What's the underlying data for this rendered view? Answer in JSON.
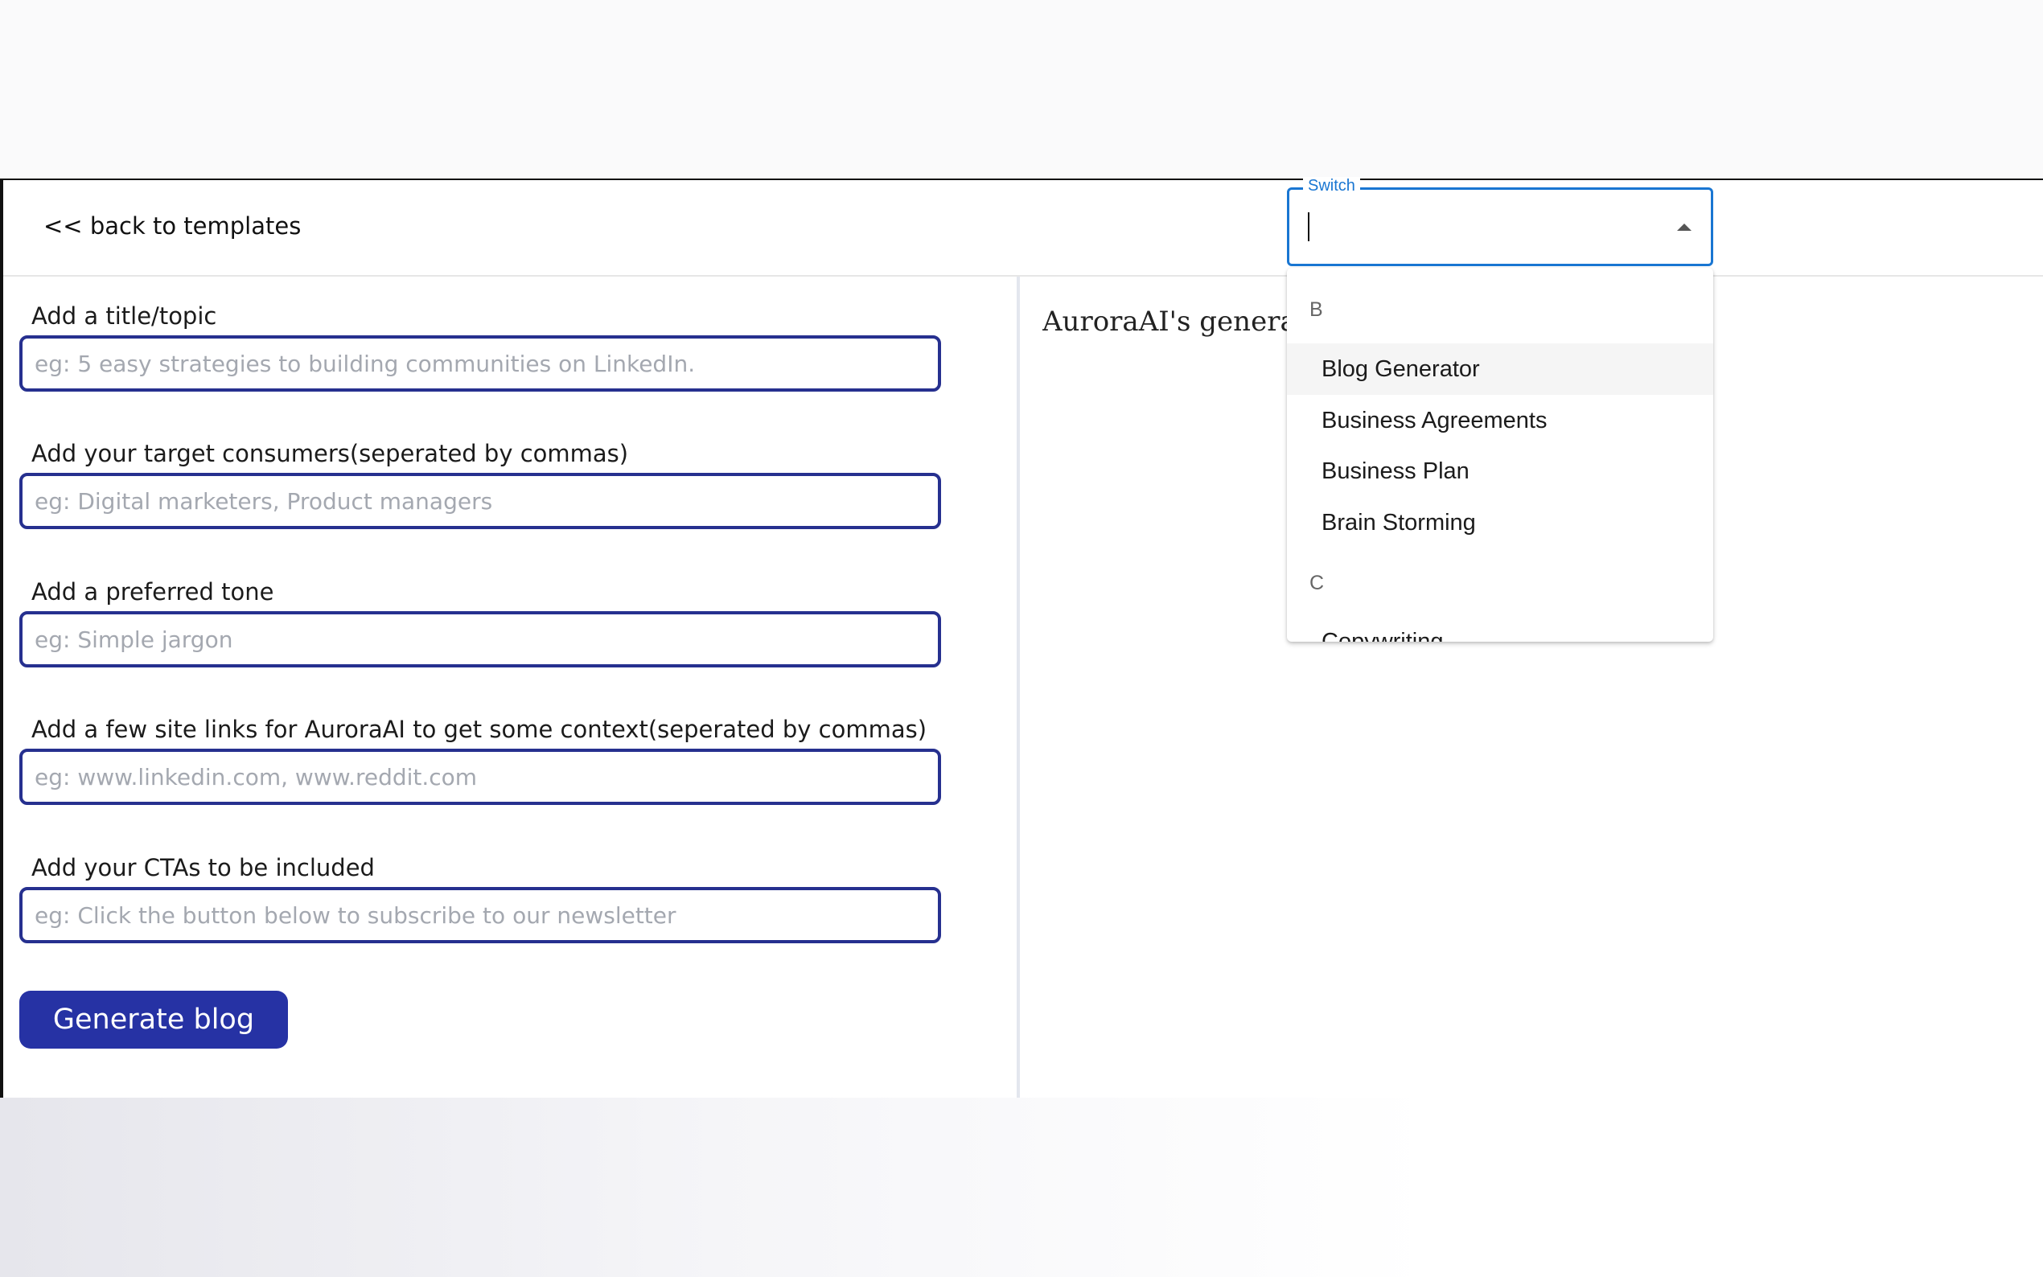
{
  "header": {
    "back_link": "<< back to templates"
  },
  "form": {
    "fields": [
      {
        "label": "Add a title/topic",
        "placeholder": "eg: 5 easy strategies to building communities on LinkedIn."
      },
      {
        "label": "Add your target consumers(seperated by commas)",
        "placeholder": "eg: Digital marketers, Product managers"
      },
      {
        "label": "Add a preferred tone",
        "placeholder": "eg: Simple jargon"
      },
      {
        "label": "Add a few site links for AuroraAI to get some context(seperated by commas)",
        "placeholder": "eg: www.linkedin.com, www.reddit.com"
      },
      {
        "label": "Add your CTAs to be included",
        "placeholder": "eg: Click the button below to subscribe to our newsletter"
      }
    ],
    "submit_label": "Generate blog"
  },
  "output": {
    "text": "AuroraAI's generati"
  },
  "switch": {
    "label": "Switch",
    "value": "",
    "groups": [
      {
        "header": "B",
        "options": [
          "Blog Generator",
          "Business Agreements",
          "Business Plan",
          "Brain Storming"
        ]
      },
      {
        "header": "C",
        "options": [
          "Copywriting"
        ]
      }
    ],
    "highlighted": "Blog Generator"
  },
  "colors": {
    "primary": "#2632a4",
    "input_border": "#26308f",
    "focus": "#1976d2"
  }
}
